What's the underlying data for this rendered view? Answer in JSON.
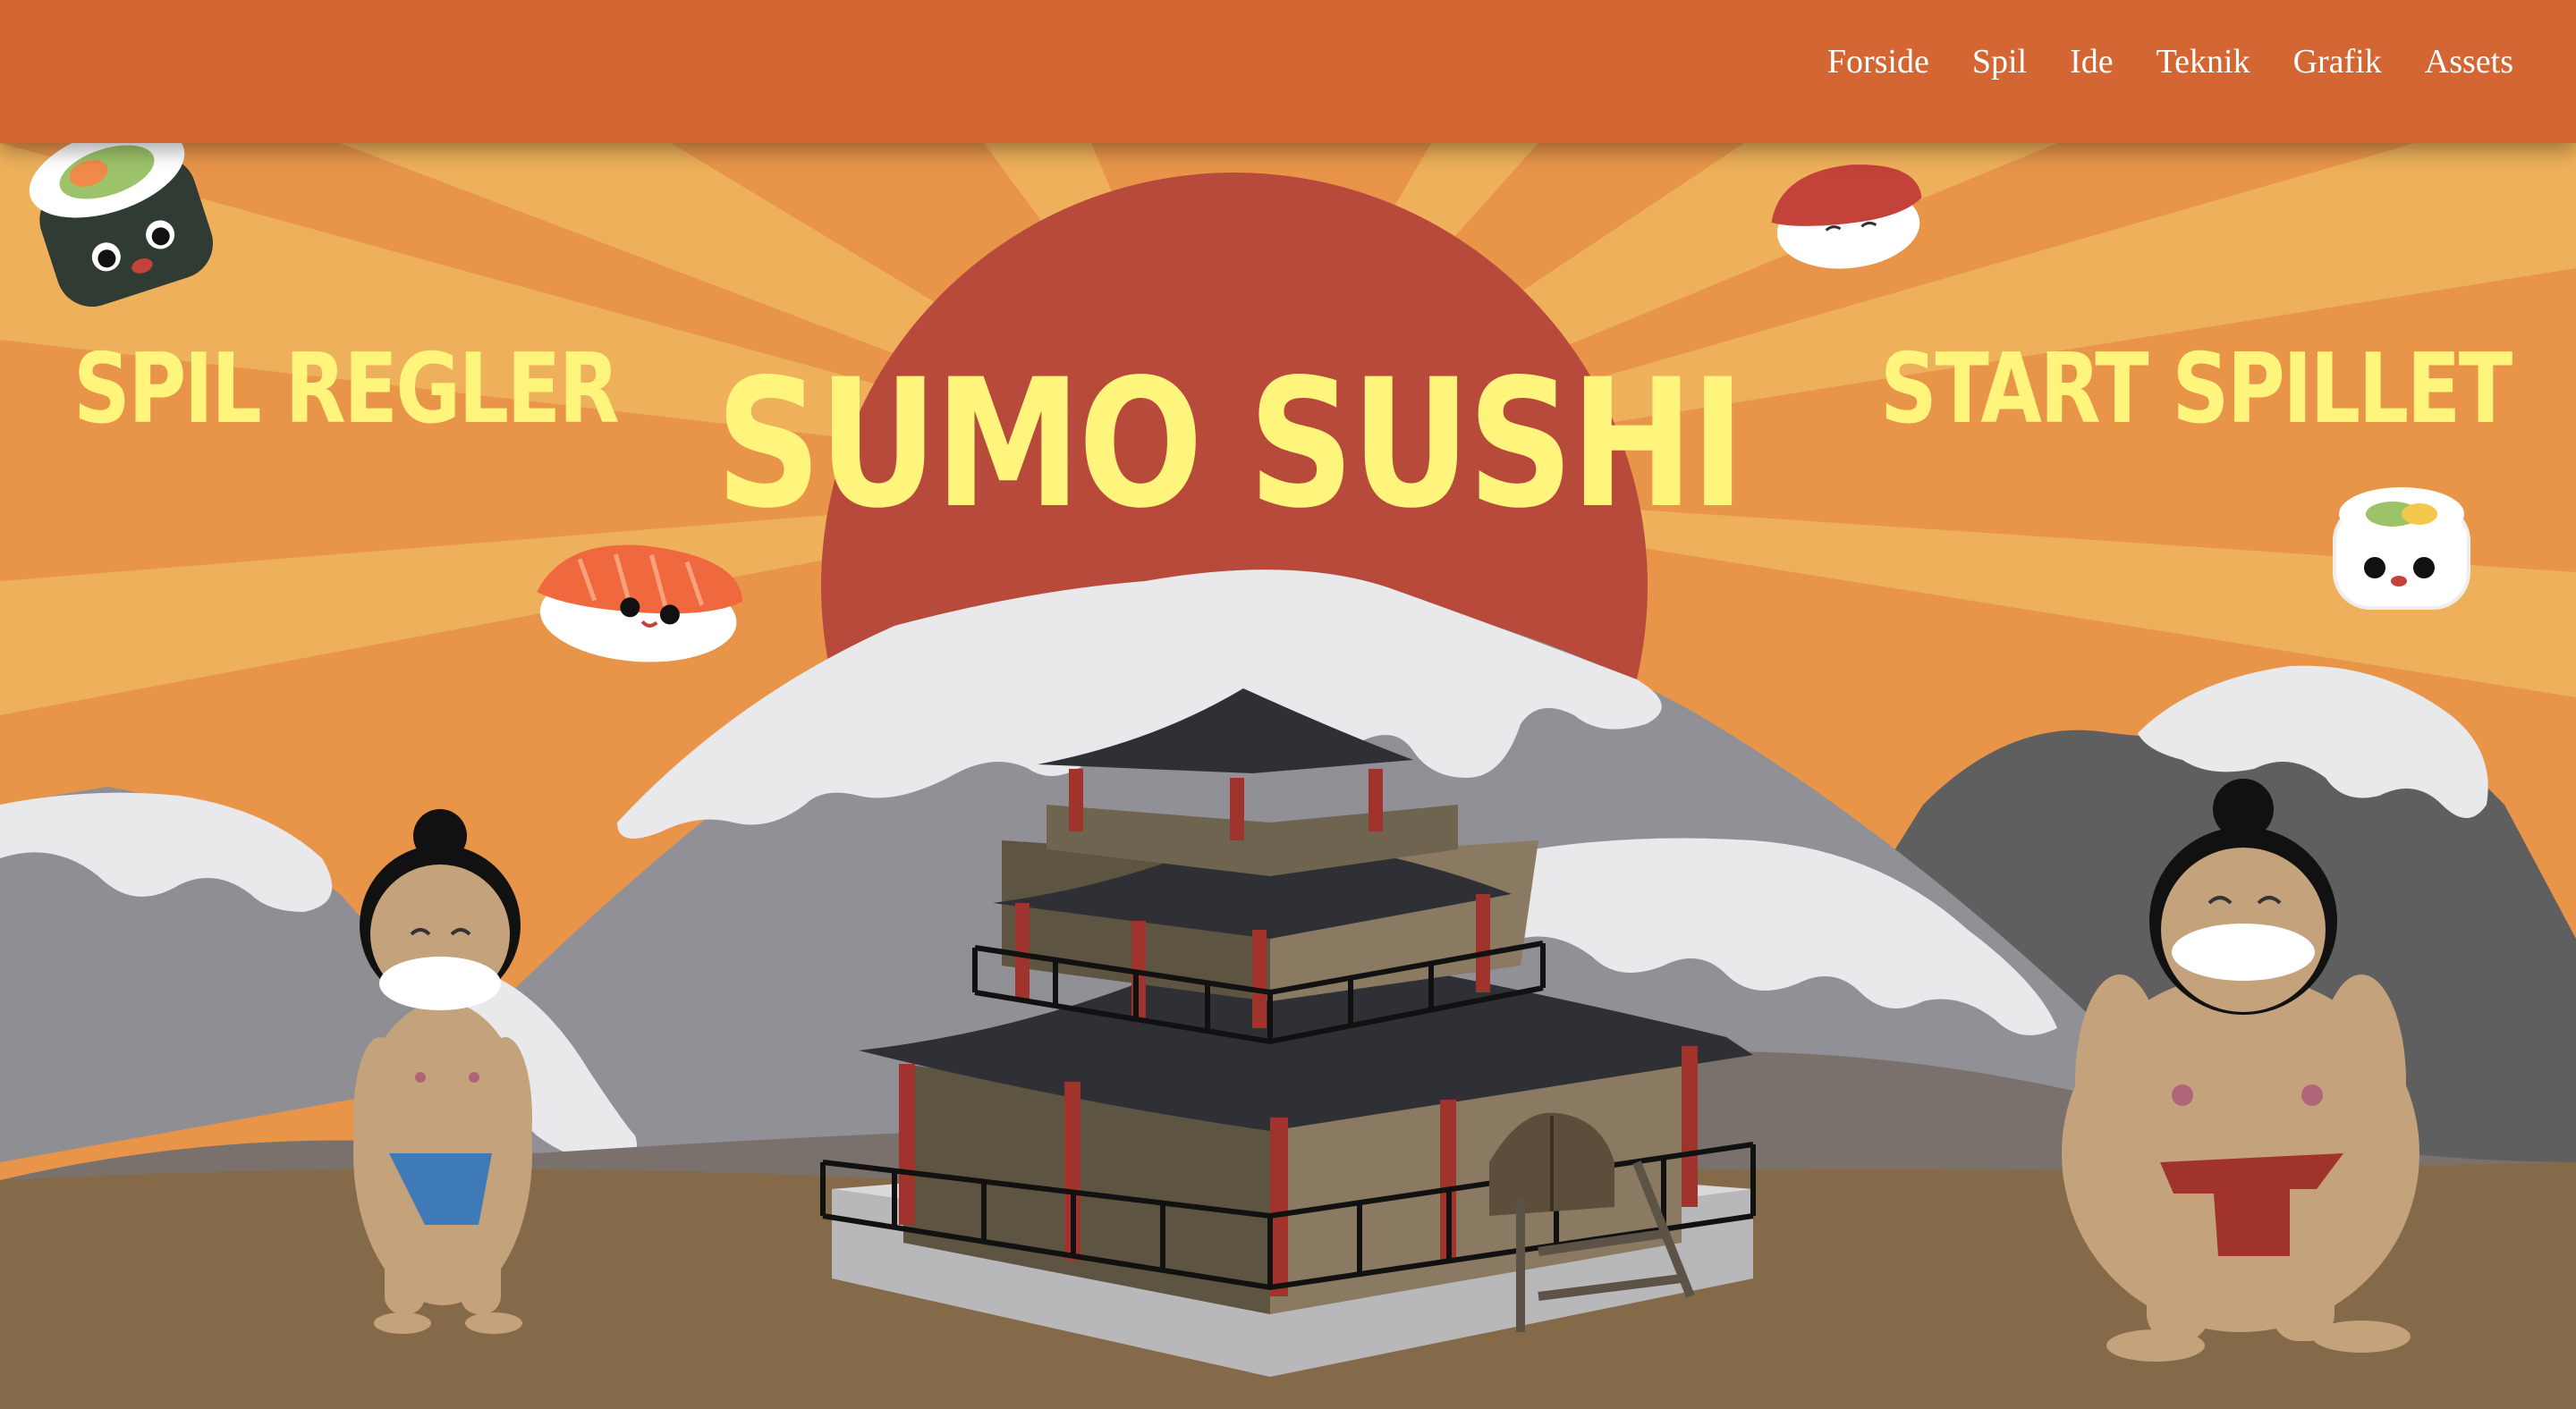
{
  "nav": {
    "items": [
      "Forside",
      "Spil",
      "Ide",
      "Teknik",
      "Grafik",
      "Assets"
    ]
  },
  "hero": {
    "title": "SUMO SUSHI",
    "rules_button": "SPIL REGLER",
    "start_button": "START SPILLET"
  },
  "colors": {
    "navbar": "#d46633",
    "title_text": "#fff47c",
    "sun": "#b84a3c",
    "ground": "#856a4a"
  },
  "icons": [
    "sushi-roll-icon",
    "nigiri-tuna-icon",
    "nigiri-salmon-icon",
    "sushi-maki-icon",
    "sumo-wrestler-small",
    "sumo-wrestler-large",
    "pagoda-temple"
  ]
}
